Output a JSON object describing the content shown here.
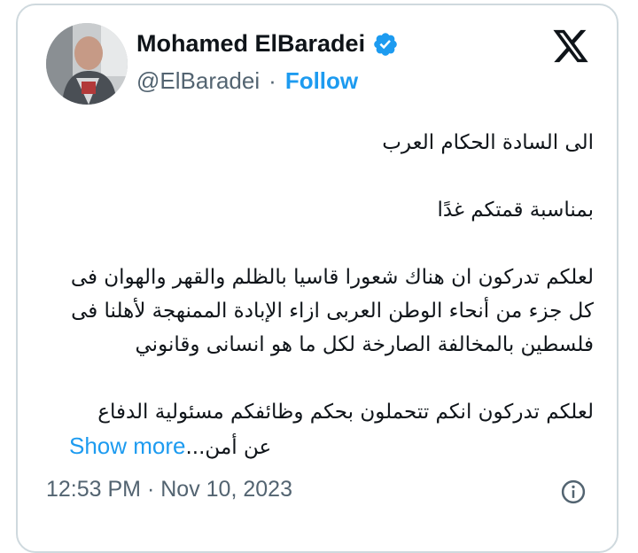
{
  "author": {
    "name": "Mohamed ElBaradei",
    "handle": "@ElBaradei",
    "separator": "·",
    "follow_label": "Follow",
    "verified_icon": "verified-badge-icon",
    "verified_color": "#1d9bf0"
  },
  "brand": {
    "logo_icon": "x-logo-icon"
  },
  "tweet": {
    "lines": [
      "الى السادة الحكام العرب",
      "",
      "بمناسبة قمتكم غدًا",
      "",
      "لعلكم تدركون ان هناك شعورا قاسيا بالظلم والقهر والهوان فى",
      "كل جزء من أنحاء الوطن العربى ازاء الإبادة  الممنهجة لأهلنا فى",
      "فلسطين بالمخالفة الصارخة لكل ما هو انسانى وقانوني",
      "",
      "لعلكم تدركون انكم تتحملون بحكم وظائفكم مسئولية الدفاع"
    ],
    "last_line": "عن أمن...",
    "show_more_label": "Show more"
  },
  "meta": {
    "time": "12:53 PM",
    "separator": "·",
    "date": "Nov 10, 2023",
    "info_icon": "info-icon"
  },
  "colors": {
    "accent": "#1d9bf0",
    "secondary_text": "#536471",
    "border": "#cfd9de"
  }
}
